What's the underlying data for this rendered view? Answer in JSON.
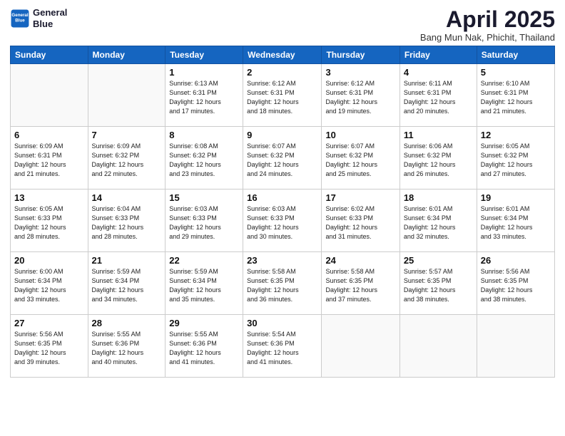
{
  "header": {
    "logo_line1": "General",
    "logo_line2": "Blue",
    "title": "April 2025",
    "location": "Bang Mun Nak, Phichit, Thailand"
  },
  "weekdays": [
    "Sunday",
    "Monday",
    "Tuesday",
    "Wednesday",
    "Thursday",
    "Friday",
    "Saturday"
  ],
  "weeks": [
    [
      {
        "day": "",
        "info": ""
      },
      {
        "day": "",
        "info": ""
      },
      {
        "day": "1",
        "info": "Sunrise: 6:13 AM\nSunset: 6:31 PM\nDaylight: 12 hours\nand 17 minutes."
      },
      {
        "day": "2",
        "info": "Sunrise: 6:12 AM\nSunset: 6:31 PM\nDaylight: 12 hours\nand 18 minutes."
      },
      {
        "day": "3",
        "info": "Sunrise: 6:12 AM\nSunset: 6:31 PM\nDaylight: 12 hours\nand 19 minutes."
      },
      {
        "day": "4",
        "info": "Sunrise: 6:11 AM\nSunset: 6:31 PM\nDaylight: 12 hours\nand 20 minutes."
      },
      {
        "day": "5",
        "info": "Sunrise: 6:10 AM\nSunset: 6:31 PM\nDaylight: 12 hours\nand 21 minutes."
      }
    ],
    [
      {
        "day": "6",
        "info": "Sunrise: 6:09 AM\nSunset: 6:31 PM\nDaylight: 12 hours\nand 21 minutes."
      },
      {
        "day": "7",
        "info": "Sunrise: 6:09 AM\nSunset: 6:32 PM\nDaylight: 12 hours\nand 22 minutes."
      },
      {
        "day": "8",
        "info": "Sunrise: 6:08 AM\nSunset: 6:32 PM\nDaylight: 12 hours\nand 23 minutes."
      },
      {
        "day": "9",
        "info": "Sunrise: 6:07 AM\nSunset: 6:32 PM\nDaylight: 12 hours\nand 24 minutes."
      },
      {
        "day": "10",
        "info": "Sunrise: 6:07 AM\nSunset: 6:32 PM\nDaylight: 12 hours\nand 25 minutes."
      },
      {
        "day": "11",
        "info": "Sunrise: 6:06 AM\nSunset: 6:32 PM\nDaylight: 12 hours\nand 26 minutes."
      },
      {
        "day": "12",
        "info": "Sunrise: 6:05 AM\nSunset: 6:32 PM\nDaylight: 12 hours\nand 27 minutes."
      }
    ],
    [
      {
        "day": "13",
        "info": "Sunrise: 6:05 AM\nSunset: 6:33 PM\nDaylight: 12 hours\nand 28 minutes."
      },
      {
        "day": "14",
        "info": "Sunrise: 6:04 AM\nSunset: 6:33 PM\nDaylight: 12 hours\nand 28 minutes."
      },
      {
        "day": "15",
        "info": "Sunrise: 6:03 AM\nSunset: 6:33 PM\nDaylight: 12 hours\nand 29 minutes."
      },
      {
        "day": "16",
        "info": "Sunrise: 6:03 AM\nSunset: 6:33 PM\nDaylight: 12 hours\nand 30 minutes."
      },
      {
        "day": "17",
        "info": "Sunrise: 6:02 AM\nSunset: 6:33 PM\nDaylight: 12 hours\nand 31 minutes."
      },
      {
        "day": "18",
        "info": "Sunrise: 6:01 AM\nSunset: 6:34 PM\nDaylight: 12 hours\nand 32 minutes."
      },
      {
        "day": "19",
        "info": "Sunrise: 6:01 AM\nSunset: 6:34 PM\nDaylight: 12 hours\nand 33 minutes."
      }
    ],
    [
      {
        "day": "20",
        "info": "Sunrise: 6:00 AM\nSunset: 6:34 PM\nDaylight: 12 hours\nand 33 minutes."
      },
      {
        "day": "21",
        "info": "Sunrise: 5:59 AM\nSunset: 6:34 PM\nDaylight: 12 hours\nand 34 minutes."
      },
      {
        "day": "22",
        "info": "Sunrise: 5:59 AM\nSunset: 6:34 PM\nDaylight: 12 hours\nand 35 minutes."
      },
      {
        "day": "23",
        "info": "Sunrise: 5:58 AM\nSunset: 6:35 PM\nDaylight: 12 hours\nand 36 minutes."
      },
      {
        "day": "24",
        "info": "Sunrise: 5:58 AM\nSunset: 6:35 PM\nDaylight: 12 hours\nand 37 minutes."
      },
      {
        "day": "25",
        "info": "Sunrise: 5:57 AM\nSunset: 6:35 PM\nDaylight: 12 hours\nand 38 minutes."
      },
      {
        "day": "26",
        "info": "Sunrise: 5:56 AM\nSunset: 6:35 PM\nDaylight: 12 hours\nand 38 minutes."
      }
    ],
    [
      {
        "day": "27",
        "info": "Sunrise: 5:56 AM\nSunset: 6:35 PM\nDaylight: 12 hours\nand 39 minutes."
      },
      {
        "day": "28",
        "info": "Sunrise: 5:55 AM\nSunset: 6:36 PM\nDaylight: 12 hours\nand 40 minutes."
      },
      {
        "day": "29",
        "info": "Sunrise: 5:55 AM\nSunset: 6:36 PM\nDaylight: 12 hours\nand 41 minutes."
      },
      {
        "day": "30",
        "info": "Sunrise: 5:54 AM\nSunset: 6:36 PM\nDaylight: 12 hours\nand 41 minutes."
      },
      {
        "day": "",
        "info": ""
      },
      {
        "day": "",
        "info": ""
      },
      {
        "day": "",
        "info": ""
      }
    ]
  ]
}
